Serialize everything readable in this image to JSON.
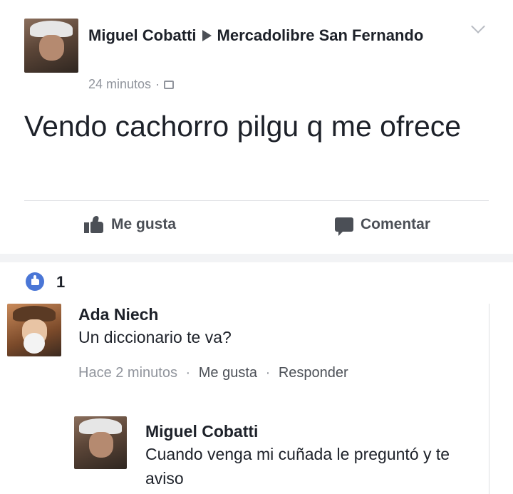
{
  "post": {
    "author": "Miguel Cobatti",
    "group": "Mercadolibre San Fernando",
    "time": "24 minutos",
    "separator": "·",
    "text": "Vendo cachorro pilgu q me ofrece",
    "actions": {
      "like": "Me gusta",
      "comment": "Comentar"
    }
  },
  "reactions": {
    "count": "1"
  },
  "comments": [
    {
      "author": "Ada Niech",
      "text": "Un diccionario te va?",
      "time": "Hace 2 minutos",
      "like": "Me gusta",
      "reply": "Responder",
      "separator": "·"
    },
    {
      "author": "Miguel Cobatti",
      "text": "Cuando venga mi cuñada le preguntó y te aviso"
    }
  ],
  "icons": {
    "arrow": "arrow-right-icon",
    "privacy": "group-privacy-icon",
    "menu": "chevron-down-icon",
    "like": "thumbs-up-icon",
    "comment": "speech-bubble-icon",
    "reaction": "like-reaction-icon"
  },
  "colors": {
    "link_blue": "#4a76d6",
    "text": "#1d2129",
    "muted": "#90949c",
    "action": "#4b4f56"
  }
}
